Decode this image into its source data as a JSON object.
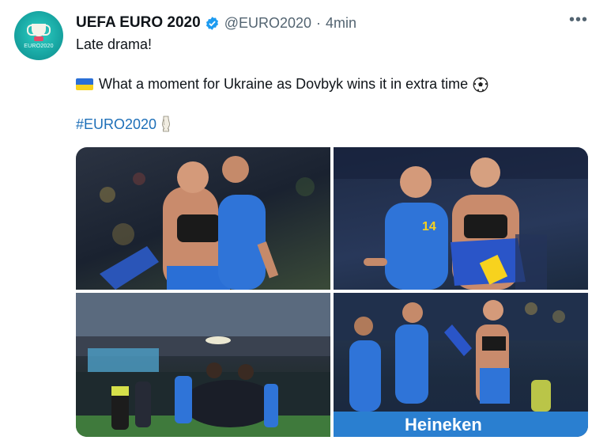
{
  "tweet": {
    "account_name": "UEFA EURO 2020",
    "handle": "@EURO2020",
    "separator": "·",
    "time": "4min",
    "more_label": "•••",
    "avatar_text": "EURO2020",
    "line1": "Late drama!",
    "line2": "What a moment for Ukraine as Dovbyk wins it in extra time",
    "hashtag": "#EURO2020",
    "photo4_banner_text": "Heineken"
  },
  "colors": {
    "accent": "#1d9bf0",
    "link": "#1d6fb8",
    "ukraine_blue": "#2a6fd6",
    "ukraine_yellow": "#f7d21e"
  },
  "icons": [
    "verified-badge-icon",
    "more-options-icon",
    "ukraine-flag-icon",
    "soccer-ball-icon",
    "trophy-icon"
  ]
}
